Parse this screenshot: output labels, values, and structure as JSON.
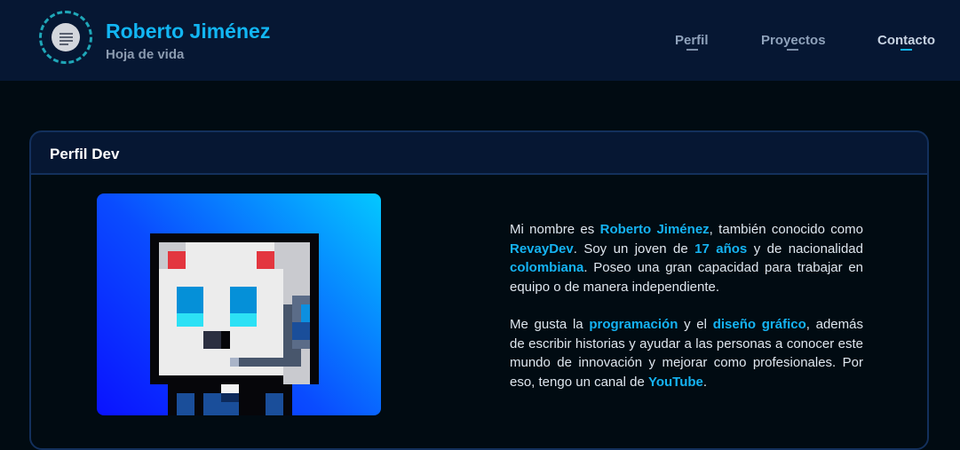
{
  "header": {
    "name": "Roberto Jiménez",
    "subtitle": "Hoja de vida",
    "logo_icon": "document-lines-icon",
    "nav": [
      {
        "label": "Perfil",
        "active": false
      },
      {
        "label": "Proyectos",
        "active": false
      },
      {
        "label": "Contacto",
        "active": true
      }
    ]
  },
  "card": {
    "title": "Perfil Dev",
    "avatar_icon": "pixel-robot-avatar",
    "bio": {
      "p1": {
        "t1": "Mi nombre es ",
        "h1": "Roberto Jiménez",
        "t2": ", también conocido como ",
        "h2": "RevayDev",
        "t3": ". Soy un joven de ",
        "h3": "17 años",
        "t4": " y de nacionalidad ",
        "h4": "colombiana",
        "t5": ". Poseo una gran capacidad para trabajar en equipo o de manera independiente."
      },
      "p2": {
        "t1": "Me gusta la ",
        "h1": "programación",
        "t2": " y el ",
        "h2": "diseño gráfico",
        "t3": ", además de escribir historias y ayudar a las personas a conocer este mundo de innovación y mejorar como profesionales. Por eso, tengo un canal de ",
        "h3": "YouTube",
        "t4": "."
      }
    }
  },
  "colors": {
    "accent": "#12b6f3",
    "header_bg": "#061733",
    "page_bg": "#010b12",
    "border": "#13305c"
  }
}
